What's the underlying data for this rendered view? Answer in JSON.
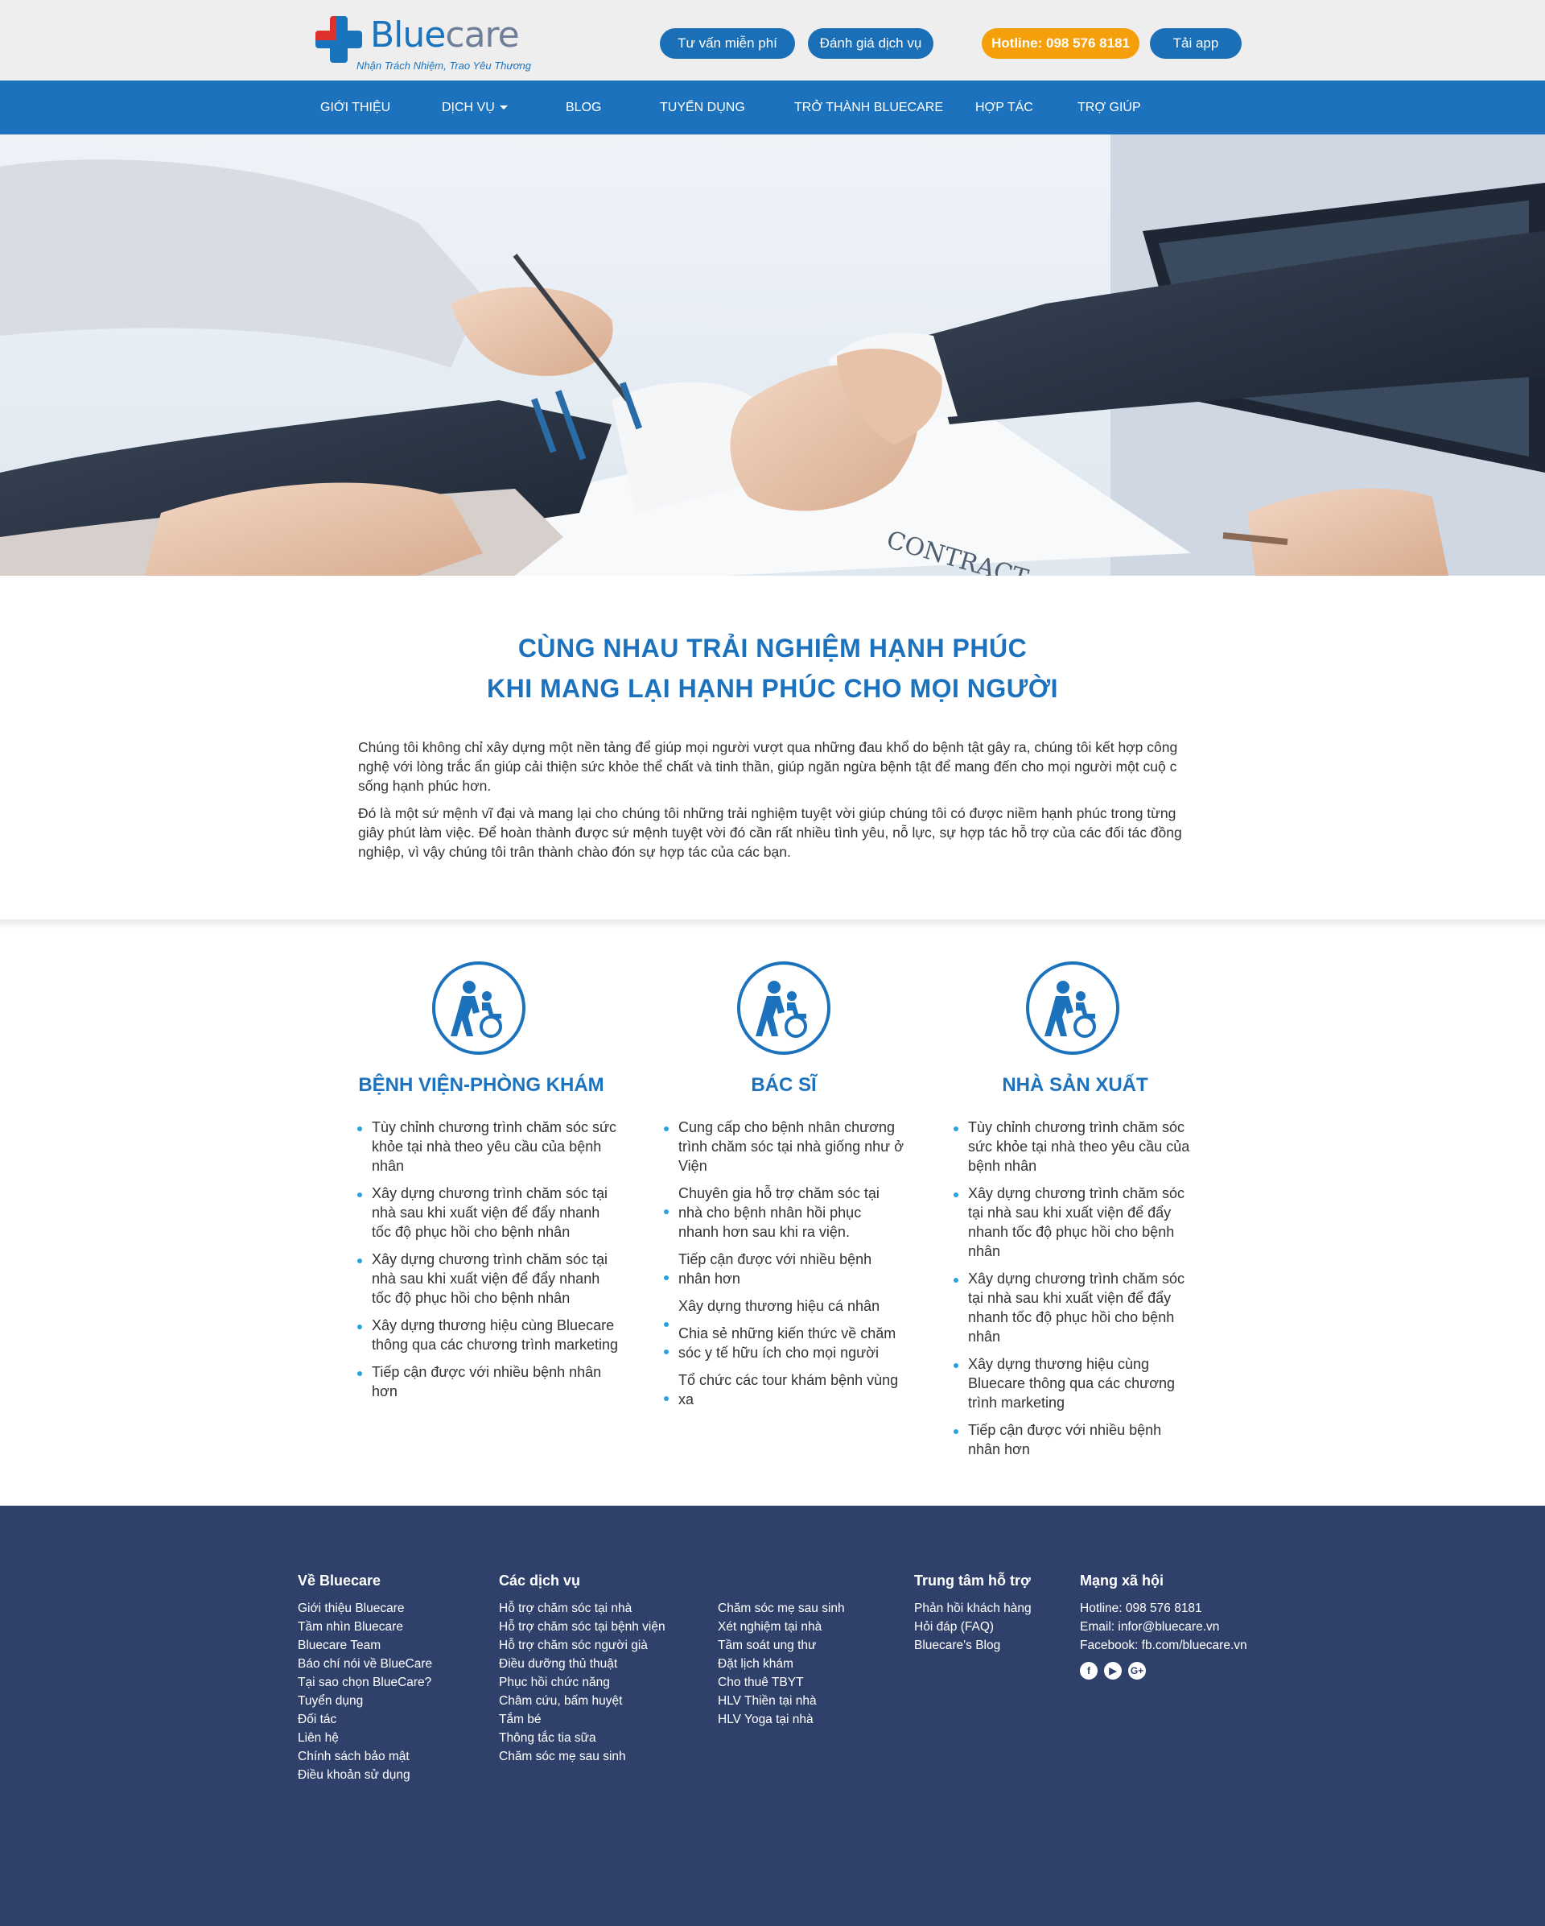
{
  "header": {
    "logo_word_blue": "Blue",
    "logo_word_care": "care",
    "logo_tagline": "Nhận Trách Nhiệm, Trao Yêu Thương",
    "btn_consult": "Tư vấn miễn phí",
    "btn_review": "Đánh giá dịch vụ",
    "btn_hotline": "Hotline: 098 576 8181",
    "btn_app": "Tải app"
  },
  "nav": {
    "items": [
      "GIỚI THIỆU",
      "DỊCH VỤ",
      "BLOG",
      "TUYỂN DỤNG",
      "TRỞ THÀNH BLUECARE",
      "HỢP TÁC",
      "TRỢ GIÚP"
    ]
  },
  "hero": {
    "contract_text": "CONTRACT"
  },
  "intro": {
    "title_line1": "CÙNG NHAU TRẢI NGHIỆM HẠNH PHÚC",
    "title_line2": "KHI MANG LẠI HẠNH PHÚC CHO MỌI NGƯỜI",
    "para1": "Chúng tôi không chỉ xây dựng một nền tảng để giúp mọi người vượt qua những đau khổ do bệnh tật gây ra, chúng tôi kết hợp công nghệ với lòng trắc ẩn giúp cải thiện sức khỏe thể chất và tinh thần, giúp ngăn ngừa bệnh tật để mang đến cho mọi người một cuộ c sống hạnh phúc hơn.",
    "para2": "Đó là một sứ mệnh vĩ đại và mang lại cho chúng tôi những trải nghiệm tuyệt vời giúp chúng tôi có được niềm hạnh phúc trong từng giây phút làm việc. Để hoàn thành được sứ mệnh tuyệt vời đó cần rất nhiều tình yêu, nỗ lực, sự hợp tác hỗ trợ của các đối tác đồng nghiệp, vì vậy chúng tôi trân thành chào đón sự hợp tác của các bạn."
  },
  "services": [
    {
      "title": "BỆNH VIỆN-PHÒNG KHÁM",
      "items": [
        "Tùy chỉnh chương trình chăm sóc sức khỏe tại nhà theo yêu cầu của bệnh nhân",
        "Xây dựng chương trình chăm sóc tại nhà sau khi xuất viện để đẩy nhanh tốc độ phục hồi cho bệnh nhân",
        "Xây dựng chương trình chăm sóc tại nhà sau khi xuất viện để đẩy nhanh tốc độ phục hồi cho bệnh nhân",
        "Xây dựng thương hiệu cùng Bluecare thông qua các chương trình marketing",
        "Tiếp cận được với nhiều bệnh nhân hơn"
      ]
    },
    {
      "title": "BÁC SĨ",
      "items": [
        "Cung cấp cho bệnh nhân chương trình chăm sóc tại nhà giống như ở Viện",
        "Chuyên gia hỗ trợ chăm sóc tại nhà  cho bệnh nhân hồi phục nhanh hơn sau khi ra viện.",
        "Tiếp cận được với nhiều bệnh nhân hơn",
        "Xây dựng thương hiệu cá nhân",
        "Chia sẻ những kiến thức về chăm sóc y tế hữu ích cho mọi người",
        "Tổ chức các tour khám bệnh vùng xa"
      ]
    },
    {
      "title": "NHÀ SẢN XUẤT",
      "items": [
        "Tùy chỉnh chương trình chăm sóc sức khỏe tại nhà theo yêu cầu của bệnh nhân",
        "Xây dựng chương trình chăm sóc tại nhà sau khi xuất viện để đẩy nhanh tốc độ phục hồi cho bệnh nhân",
        "Xây dựng chương trình chăm sóc tại nhà sau khi xuất viện để đẩy nhanh tốc độ phục hồi cho bệnh nhân",
        "Xây dựng thương hiệu cùng Bluecare thông qua các chương trình marketing",
        "Tiếp cận được với nhiều bệnh nhân hơn"
      ]
    }
  ],
  "footer": {
    "about": {
      "heading": "Về Bluecare",
      "links": [
        "Giới thiệu Bluecare",
        "Tầm nhìn Bluecare",
        "Bluecare Team",
        "Báo chí nói về BlueCare",
        "Tại sao chọn BlueCare?",
        "Tuyển dụng",
        "Đối tác",
        "Liên hệ",
        "Chính sách bảo mật",
        "Điều khoản sử dụng"
      ]
    },
    "services": {
      "heading": "Các dịch vụ",
      "links_col1": [
        "Hỗ trợ chăm sóc tại nhà",
        "Hỗ trợ chăm sóc tại bệnh viện",
        "Hỗ trợ chăm sóc người già",
        "Điều dưỡng thủ thuật",
        "Phục hồi chức năng",
        "Châm cứu, bấm huyệt",
        "Tắm bé",
        "Thông tắc tia sữa",
        "Chăm sóc mẹ sau sinh"
      ],
      "links_col2": [
        "Chăm sóc mẹ sau sinh",
        "Xét nghiệm tại nhà",
        "Tầm soát ung thư",
        "Đặt lịch khám",
        "Cho thuê TBYT",
        "HLV Thiền tại nhà",
        "HLV Yoga tại nhà"
      ]
    },
    "support": {
      "heading": "Trung tâm hỗ trợ",
      "links": [
        "Phản hồi khách hàng",
        "Hỏi đáp (FAQ)",
        "Bluecare's Blog"
      ]
    },
    "social": {
      "heading": "Mạng xã hội",
      "lines": [
        "Hotline: 098 576 8181",
        "Email: infor@bluecare.vn",
        "Facebook: fb.com/bluecare.vn"
      ],
      "icons": [
        "facebook-icon",
        "youtube-icon",
        "google-plus-icon"
      ]
    }
  },
  "colors": {
    "brand_blue": "#1c72bd",
    "hotline_orange": "#f5a00a",
    "footer_bg": "#2f416b",
    "bullet": "#2aa0e0"
  }
}
